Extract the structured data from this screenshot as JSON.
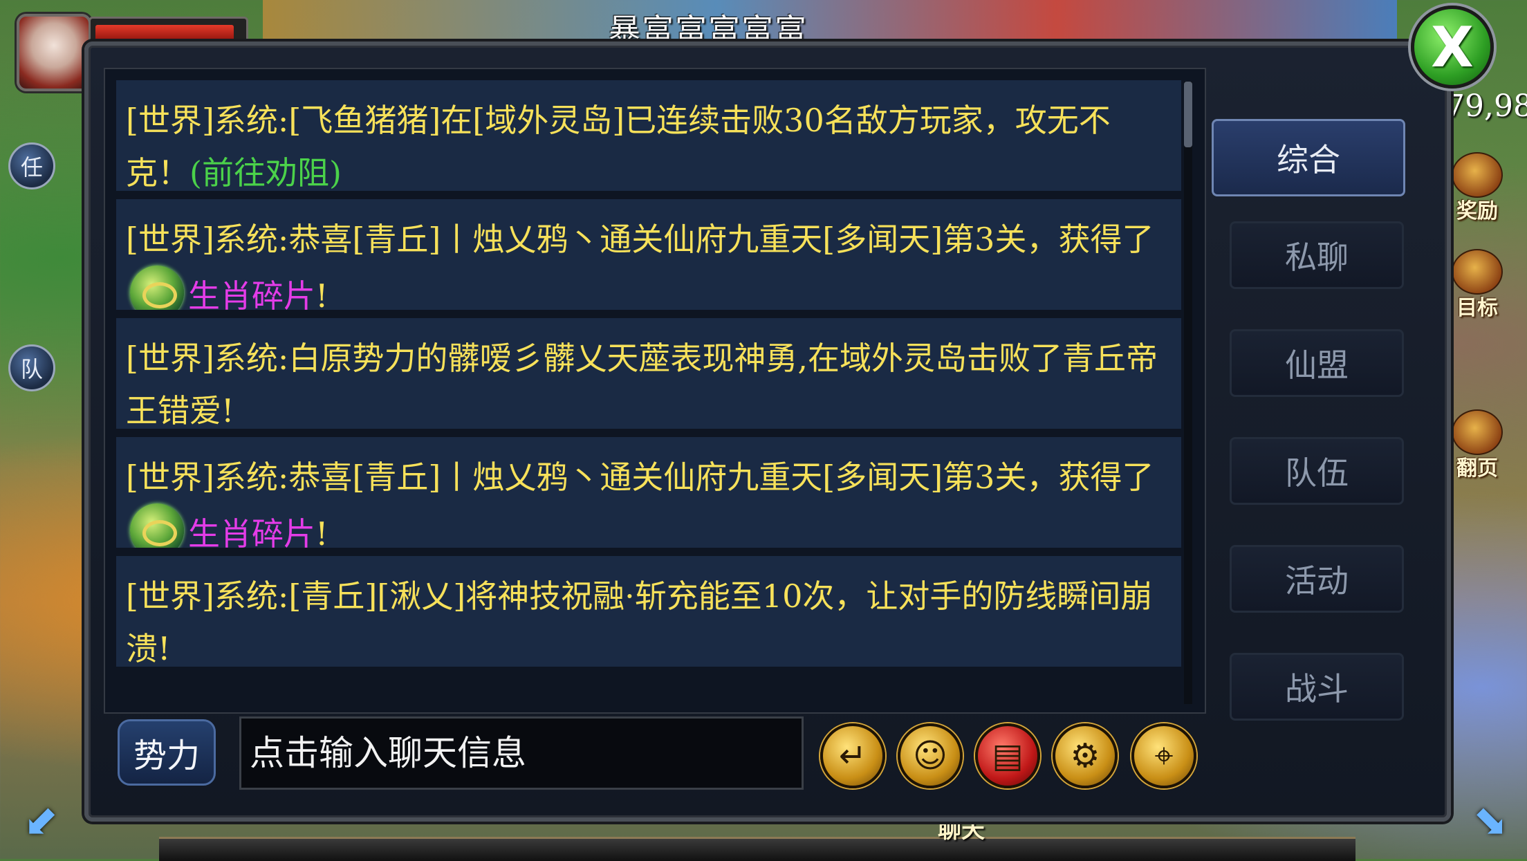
{
  "hud": {
    "title": "暴富富富富富",
    "right_number": "79,98",
    "left_buttons": [
      "任",
      "队"
    ],
    "side_icons": [
      "奖励",
      "目标",
      "翻页"
    ],
    "bottom_label": "聊天"
  },
  "messages": [
    {
      "text": "[世界]系统:[飞鱼猪猪]在[域外灵岛]已连续击败30名敌方玩家，攻无不克！",
      "link": "(前往劝阻)"
    },
    {
      "text": "[世界]系统:恭喜[青丘]丨烛乂鸦丶通关仙府九重天[多闻天]第3关，获得了",
      "item": "生肖碎片",
      "suffix": "!"
    },
    {
      "text": "[世界]系统:白原势力的髒嗳彡髒乂天蓙表现神勇,在域外灵岛击败了青丘帝王错爱!"
    },
    {
      "text": "[世界]系统:恭喜[青丘]丨烛乂鸦丶通关仙府九重天[多闻天]第3关，获得了",
      "item": "生肖碎片",
      "suffix": "!"
    },
    {
      "text": "[世界]系统:[青丘][湫乂]将神技祝融·斩充能至10次，让对手的防线瞬间崩溃!"
    }
  ],
  "tabs": [
    {
      "label": "综合",
      "active": true
    },
    {
      "label": "私聊"
    },
    {
      "label": "仙盟"
    },
    {
      "label": "队伍"
    },
    {
      "label": "活动"
    },
    {
      "label": "战斗"
    }
  ],
  "input": {
    "channel": "势力",
    "placeholder": "点击输入聊天信息"
  },
  "icons": [
    "return-icon",
    "emoji-icon",
    "red-packet-icon",
    "gear-icon",
    "location-icon"
  ],
  "close_label": "X"
}
